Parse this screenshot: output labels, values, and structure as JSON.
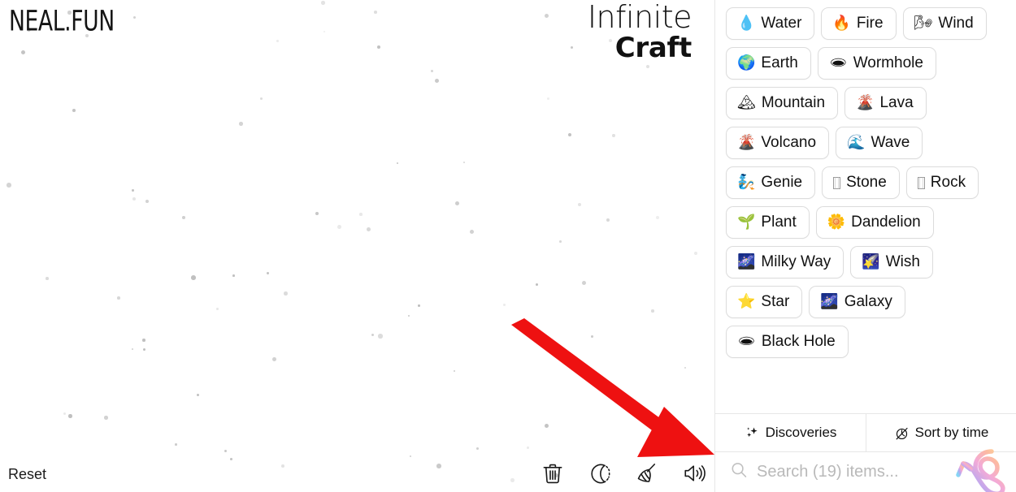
{
  "brand": {
    "label": "NEAL.FUN"
  },
  "game_title": {
    "line1": "Infinite",
    "line2": "Craft"
  },
  "canvas": {
    "reset_label": "Reset",
    "tools": [
      {
        "name": "trash-icon",
        "label": "Clear board"
      },
      {
        "name": "moon-icon",
        "label": "Dark mode"
      },
      {
        "name": "broom-icon",
        "label": "Tidy up"
      },
      {
        "name": "sound-icon",
        "label": "Sound"
      }
    ]
  },
  "annotation": {
    "arrow_color": "#ee1111",
    "points_to": "search-input"
  },
  "sidebar": {
    "items": [
      {
        "label": "Water",
        "emoji": "💧",
        "glyph": "emoji"
      },
      {
        "label": "Fire",
        "emoji": "🔥",
        "glyph": "emoji"
      },
      {
        "label": "Wind",
        "emoji": "🌬",
        "glyph": "emoji"
      },
      {
        "label": "Earth",
        "emoji": "🌍",
        "glyph": "emoji"
      },
      {
        "label": "Wormhole",
        "emoji": "🕳",
        "glyph": "emoji"
      },
      {
        "label": "Mountain",
        "emoji": "🏔",
        "glyph": "emoji"
      },
      {
        "label": "Lava",
        "emoji": "🌋",
        "glyph": "emoji"
      },
      {
        "label": "Volcano",
        "emoji": "🌋",
        "glyph": "emoji"
      },
      {
        "label": "Wave",
        "emoji": "🌊",
        "glyph": "emoji"
      },
      {
        "label": "Genie",
        "emoji": "🧞",
        "glyph": "emoji"
      },
      {
        "label": "Stone",
        "emoji": "",
        "glyph": "tofu"
      },
      {
        "label": "Rock",
        "emoji": "",
        "glyph": "tofu"
      },
      {
        "label": "Plant",
        "emoji": "🌱",
        "glyph": "emoji"
      },
      {
        "label": "Dandelion",
        "emoji": "🌼",
        "glyph": "emoji"
      },
      {
        "label": "Milky Way",
        "emoji": "🌌",
        "glyph": "emoji"
      },
      {
        "label": "Wish",
        "emoji": "🌠",
        "glyph": "emoji"
      },
      {
        "label": "Star",
        "emoji": "⭐",
        "glyph": "emoji"
      },
      {
        "label": "Galaxy",
        "emoji": "🌌",
        "glyph": "emoji"
      },
      {
        "label": "Black Hole",
        "emoji": "🕳",
        "glyph": "emoji"
      }
    ],
    "tabs": [
      {
        "label": "Discoveries",
        "icon": "sparkles-icon"
      },
      {
        "label": "Sort by time",
        "icon": "stopwatch-icon"
      }
    ],
    "search": {
      "value": "",
      "placeholder": "Search (19) items...",
      "item_count": 19
    }
  },
  "colors": {
    "pill_border": "#dcdcdc",
    "divider": "#e6e6e6",
    "text": "#111111",
    "placeholder": "#b9b9b9",
    "arrow_red": "#ee1111"
  }
}
